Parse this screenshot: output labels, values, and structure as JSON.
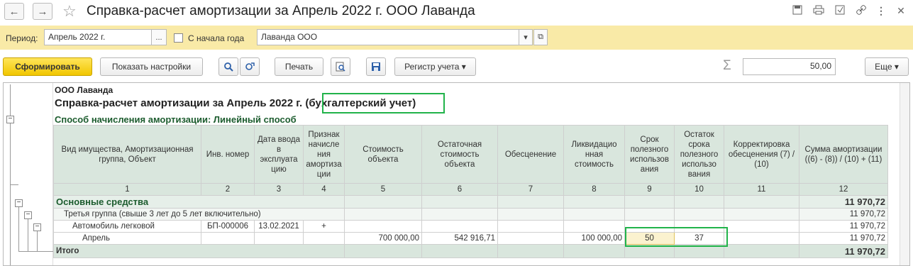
{
  "window": {
    "title": "Справка-расчет амортизации за Апрель 2022 г. ООО Лаванда",
    "back_icon": "←",
    "forward_icon": "→",
    "star_icon": "☆",
    "more_icon": "⋮",
    "close_icon": "✕"
  },
  "filters": {
    "period_label": "Период:",
    "period_value": "Апрель 2022 г.",
    "period_button": "...",
    "from_year_label": "С начала года",
    "org_value": "Лаванда ООО",
    "org_dropdown": "▾",
    "org_open": "⧉"
  },
  "toolbar": {
    "generate": "Сформировать",
    "show_settings": "Показать настройки",
    "print": "Печать",
    "register": "Регистр учета",
    "register_arrow": "▾",
    "sum_icon": "Σ",
    "sum_value": "50,00",
    "more": "Еще",
    "more_arrow": "▾"
  },
  "report": {
    "org": "ООО Лаванда",
    "title": "Справка-расчет амортизации за Апрель 2022 г.",
    "title_suffix": "(бухгалтерский учет)",
    "method": "Способ начисления амортизации:  Линейный способ",
    "headers": [
      "Вид имущества, Амортизационная группа, Объект",
      "Инв. номер",
      "Дата ввода в эксплуата цию",
      "Признак начисле ния амортиза ции",
      "Стоимость объекта",
      "Остаточная стоимость объекта",
      "Обесценение",
      "Ликвидацио нная стоимость",
      "Срок полезного использов ания",
      "Остаток срока полезного использо вания",
      "Корректировка обесценения (7) / (10)",
      "Сумма амортизации ((6) - (8)) / (10) + (11)"
    ],
    "col_numbers": [
      "1",
      "2",
      "3",
      "4",
      "5",
      "6",
      "7",
      "8",
      "9",
      "10",
      "11",
      "12"
    ],
    "rows": {
      "os": {
        "name": "Основные средства",
        "sum": "11 970,72"
      },
      "group": {
        "name": "Третья группа (свыше 3 лет до 5 лет включительно)",
        "sum": "11 970,72"
      },
      "object": {
        "name": "Автомобиль легковой",
        "inv": "БП-000006",
        "date": "13.02.2021",
        "flag": "+",
        "sum": "11 970,72"
      },
      "month": {
        "name": "Апрель",
        "cost": "700 000,00",
        "residual": "542 916,71",
        "liquid": "100 000,00",
        "term": "50",
        "remain": "37",
        "sum": "11 970,72"
      },
      "total": {
        "name": "Итого",
        "sum": "11 970,72"
      }
    }
  },
  "colors": {
    "highlight": "#21b34a",
    "header_bg": "#d9e6dd",
    "filter_bar": "#f9eaa7",
    "primary_button": "#f1c600"
  }
}
